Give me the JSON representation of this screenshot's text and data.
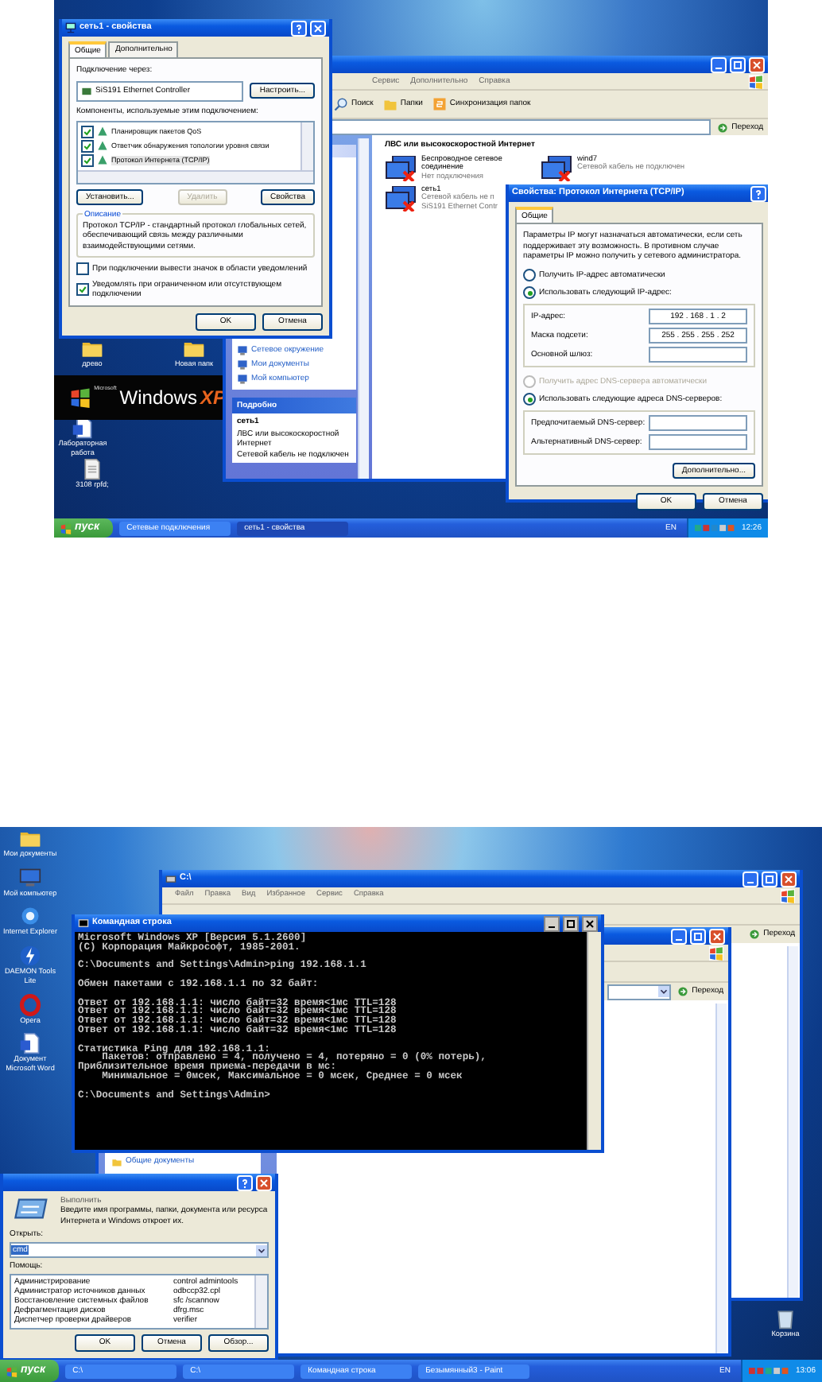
{
  "screenshot_1": {
    "desktop_icons": [
      {
        "label": "древо",
        "kind": "folder"
      },
      {
        "label": "Новая папк",
        "kind": "folder"
      },
      {
        "label": "Лабораторная работа",
        "kind": "document"
      },
      {
        "label": "3108 rpfd;",
        "kind": "file"
      }
    ],
    "logo": {
      "maker": "Microsoft",
      "name": "Windows",
      "edition": "XP"
    },
    "explorer": {
      "menu": [
        "Сервис",
        "Дополнительно",
        "Справка"
      ],
      "toolbar": [
        {
          "label": "Поиск",
          "kind": "search"
        },
        {
          "label": "Папки",
          "kind": "folders"
        },
        {
          "label": "Синхронизация папок",
          "kind": "sync"
        }
      ],
      "go": "Переход",
      "section": "ЛВС или высокоскоростной Интернет",
      "connections": [
        {
          "lines": [
            "Беспроводное сетевое соединение",
            "Нет подключения"
          ]
        },
        {
          "lines": [
            "wind7",
            "Сетевой кабель не подключен"
          ]
        },
        {
          "lines": [
            "сеть1",
            "Сетевой кабель не п",
            "SiS191 Ethernet Contr"
          ]
        }
      ],
      "side_links": [
        "Сетевое окружение",
        "Мои документы",
        "Мой компьютер"
      ],
      "details": {
        "title": "Подробно",
        "name": "сеть1",
        "lines": [
          "ЛВС или высокоскоростной Интернет",
          "Сетевой кабель не подключен"
        ]
      }
    },
    "connection_dialog": {
      "title": "сеть1 - свойства",
      "tabs": [
        {
          "label": "Общие",
          "selected": true
        },
        {
          "label": "Дополнительно",
          "selected": false
        }
      ],
      "connect_label": "Подключение через:",
      "adapter": "SiS191 Ethernet Controller",
      "configure": "Настроить...",
      "components_label": "Компоненты, используемые этим подключением:",
      "components": [
        {
          "label": "Планировщик пакетов QoS",
          "checked": true,
          "selected": false
        },
        {
          "label": "Ответчик обнаружения топологии уровня связи",
          "checked": true,
          "selected": false
        },
        {
          "label": "Протокол Интернета (TCP/IP)",
          "checked": true,
          "selected": true
        }
      ],
      "actions": [
        {
          "label": "Установить...",
          "disabled": false
        },
        {
          "label": "Удалить",
          "disabled": true
        },
        {
          "label": "Свойства",
          "disabled": false
        }
      ],
      "description_label": "Описание",
      "description": "Протокол TCP/IP - стандартный протокол глобальных сетей, обеспечивающий связь между различными взаимодействующими сетями.",
      "options": [
        {
          "label": "При подключении вывести значок в области уведомлений",
          "checked": false
        },
        {
          "label": "Уведомлять при ограниченном или отсутствующем подключении",
          "checked": true
        }
      ],
      "buttons": [
        "OK",
        "Отмена"
      ]
    },
    "tcp_dialog": {
      "title": "Свойства: Протокол Интернета (TCP/IP)",
      "tab": "Общие",
      "intro": "Параметры IP могут назначаться автоматически, если сеть поддерживает эту возможность. В противном случае параметры IP можно получить у сетевого администратора.",
      "ip_modes": [
        {
          "label": "Получить IP-адрес автоматически",
          "selected": false,
          "disabled": false
        },
        {
          "label": "Использовать следующий IP-адрес:",
          "selected": true,
          "disabled": false
        }
      ],
      "ip_fields": [
        {
          "label": "IP-адрес:",
          "value": "192 . 168 . 1 . 2"
        },
        {
          "label": "Маска подсети:",
          "value": "255 . 255 . 255 . 252"
        },
        {
          "label": "Основной шлюз:"
        }
      ],
      "dns_modes": [
        {
          "label": "Получить адрес DNS-сервера автоматически",
          "selected": false,
          "disabled": true
        },
        {
          "label": "Использовать следующие адреса DNS-серверов:",
          "selected": true,
          "disabled": false
        }
      ],
      "dns_fields": [
        {
          "label": "Предпочитаемый DNS-сервер:"
        },
        {
          "label": "Альтернативный DNS-сервер:"
        }
      ],
      "advanced": "Дополнительно...",
      "buttons": [
        "OK",
        "Отмена"
      ]
    },
    "taskbar": {
      "start": "пуск",
      "tasks": [
        {
          "label": "Сетевые подключения",
          "selected": false
        },
        {
          "label": "сеть1 - свойства",
          "selected": true
        }
      ],
      "language": "EN",
      "time": "12:26"
    }
  },
  "screenshot_2": {
    "desktop_icons": [
      {
        "label": "Мои документы",
        "kind": "folder"
      },
      {
        "label": "Мой компьютер",
        "kind": "computer"
      },
      {
        "label": "Internet Explorer",
        "kind": "browser"
      },
      {
        "label": "DAEMON Tools Lite",
        "kind": "tool"
      },
      {
        "label": "Opera",
        "kind": "opera"
      },
      {
        "label": "Документ Microsoft Word",
        "kind": "document"
      }
    ],
    "recycle_bin": {
      "label": "Корзина"
    },
    "explorer": {
      "title": "C:\\",
      "menu": [
        "Файл",
        "Правка",
        "Вид",
        "Избранное",
        "Сервис",
        "Справка"
      ],
      "go": "Переход"
    },
    "explorer_2": {
      "go": "Переход",
      "folder": "Общие документы"
    },
    "console": {
      "title": "Командная строка",
      "blocks": [
        [
          "Microsoft Windows XP [Версия 5.1.2600]",
          "(С) Корпорация Майкрософт, 1985-2001."
        ],
        [
          "C:\\Documents and Settings\\Admin>ping 192.168.1.1"
        ],
        [
          "Обмен пакетами с 192.168.1.1 по 32 байт:"
        ],
        [
          "Ответ от 192.168.1.1: число байт=32 время<1мс TTL=128",
          "Ответ от 192.168.1.1: число байт=32 время<1мс TTL=128",
          "Ответ от 192.168.1.1: число байт=32 время<1мс TTL=128",
          "Ответ от 192.168.1.1: число байт=32 время<1мс TTL=128"
        ],
        [
          "Статистика Ping для 192.168.1.1:",
          "    Пакетов: отправлено = 4, получено = 4, потеряно = 0 (0% потерь),",
          "Приблизительное время приема-передачи в мс:",
          "    Минимальное = 0мсек, Максимальное = 0 мсек, Среднее = 0 мсек"
        ],
        [
          "C:\\Documents and Settings\\Admin>"
        ]
      ]
    },
    "run_dialog": {
      "heading": "Выполнить",
      "prompt": "Введите имя программы, папки, документа или ресурса Интернета и Windows откроет их.",
      "open_label": "Открыть:",
      "value": "cmd",
      "help_label": "Помощь:",
      "rows": [
        [
          "Администрирование",
          "control admintools"
        ],
        [
          "Администратор источников данных",
          "odbccp32.cpl"
        ],
        [
          "Восстановление системных файлов",
          "sfc /scannow"
        ],
        [
          "Дефрагментация дисков",
          "dfrg.msc"
        ],
        [
          "Диспетчер проверки драйверов",
          "verifier"
        ]
      ],
      "buttons": [
        "OK",
        "Отмена",
        "Обзор..."
      ]
    },
    "taskbar": {
      "start": "пуск",
      "tasks": [
        {
          "label": "C:\\",
          "selected": false
        },
        {
          "label": "C:\\",
          "selected": false
        },
        {
          "label": "Командная строка",
          "selected": false
        },
        {
          "label": "Безымянный3 - Paint",
          "selected": false
        }
      ],
      "language": "EN",
      "time": "13:06"
    }
  }
}
